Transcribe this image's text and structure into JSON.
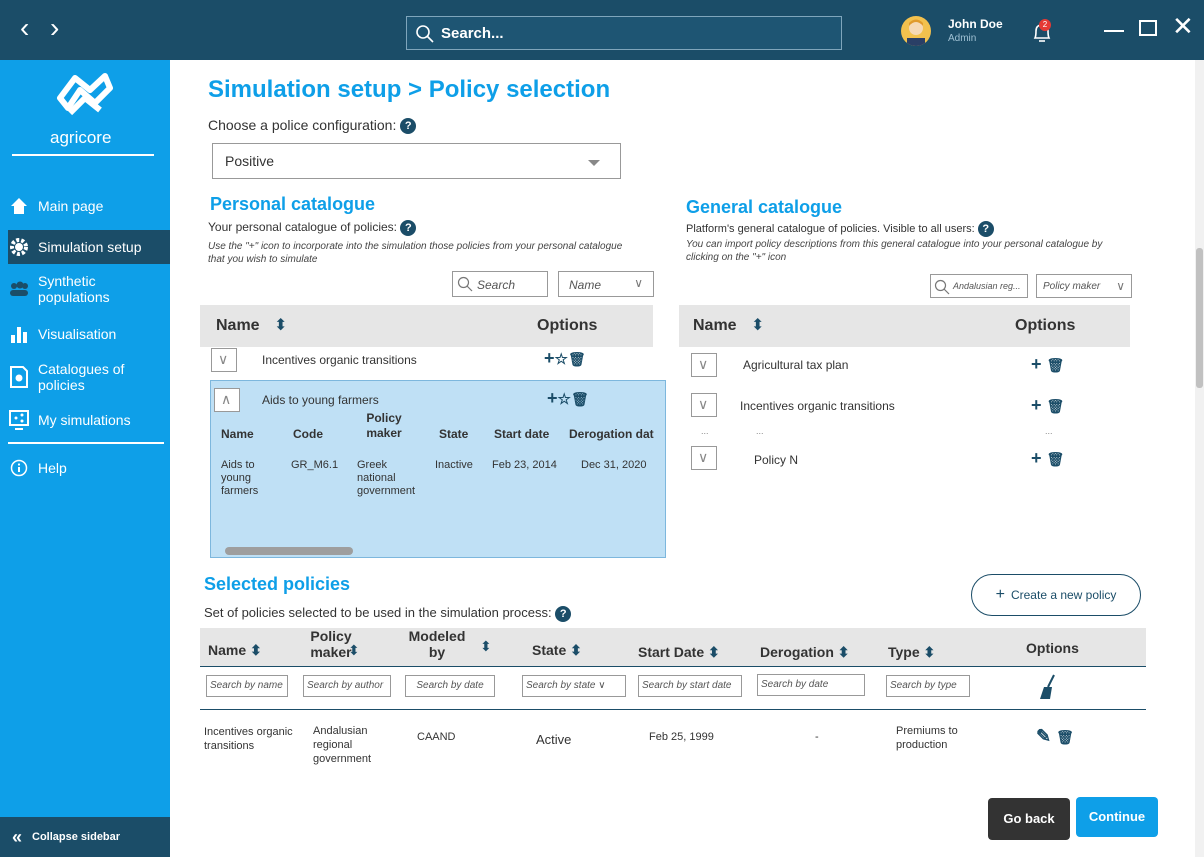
{
  "topbar": {
    "back_icon": "chevron-left-icon",
    "forward_icon": "chevron-right-icon",
    "search_placeholder": "Search...",
    "user_name": "John Doe",
    "user_role": "Admin",
    "notification_count": "2"
  },
  "sidebar": {
    "logo_text": "agricore",
    "items": [
      {
        "label": "Main page",
        "icon": "home-icon"
      },
      {
        "label": "Simulation setup",
        "icon": "gear-icon"
      },
      {
        "label": "Synthetic populations",
        "icon": "people-icon"
      },
      {
        "label": "Visualisation",
        "icon": "bar-chart-icon"
      },
      {
        "label": "Catalogues of policies",
        "icon": "catalogue-icon"
      },
      {
        "label": "My simulations",
        "icon": "share-screen-icon"
      },
      {
        "label": "Help",
        "icon": "info-icon"
      }
    ],
    "collapse_label": "Collapse sidebar"
  },
  "page": {
    "title": "Simulation setup > Policy selection",
    "config_label": "Choose a police configuration:",
    "config_value": "Positive"
  },
  "personal": {
    "title": "Personal catalogue",
    "subtitle": "Your personal catalogue of policies:",
    "hint": "Use the \"+\" icon to incorporate into the simulation those policies from your personal catalogue that you wish to simulate",
    "search_placeholder": "Search",
    "sort_value": "Name",
    "col_name": "Name",
    "col_options": "Options",
    "rows": [
      "Incentives organic transitions",
      "Aids to young farmers"
    ],
    "detail_headers": [
      "Name",
      "Code",
      "Policy maker",
      "State",
      "Start date",
      "Derogation dat"
    ],
    "detail_values": [
      "Aids to young farmers",
      "GR_M6.1",
      "Greek national government",
      "Inactive",
      "Feb 23, 2014",
      "Dec 31, 2020"
    ]
  },
  "general": {
    "title": "General catalogue",
    "subtitle": "Platform's general catalogue of policies. Visible to all users:",
    "hint": "You can import policy descriptions from this general catalogue into your personal catalogue by clicking on the \"+\" icon",
    "search_value": "Andalusian reg...",
    "filter_value": "Policy maker",
    "col_name": "Name",
    "col_options": "Options",
    "rows": [
      "Agricultural tax plan",
      "Incentives organic transitions",
      "...",
      "Policy N"
    ]
  },
  "selected": {
    "title": "Selected policies",
    "subtitle": "Set of policies selected to be used in the simulation process:",
    "create_label": "Create a new policy",
    "headers": [
      "Name",
      "Policy maker",
      "Modeled by",
      "State",
      "Start Date",
      "Derogation",
      "Type",
      "Options"
    ],
    "filters": [
      "Search by name",
      "Search by author",
      "Search by date",
      "Search by state",
      "Search by start date",
      "Search by  date",
      "Search by  type"
    ],
    "row": [
      "Incentives organic transitions",
      "Andalusian regional government",
      "CAAND",
      "Active",
      "Feb 25, 1999",
      "-",
      "Premiums to production"
    ]
  },
  "actions": {
    "back": "Go back",
    "continue": "Continue"
  },
  "colors": {
    "accent": "#0e9fe8",
    "dark": "#1b4d68",
    "highlight": "#bfe0f5"
  }
}
